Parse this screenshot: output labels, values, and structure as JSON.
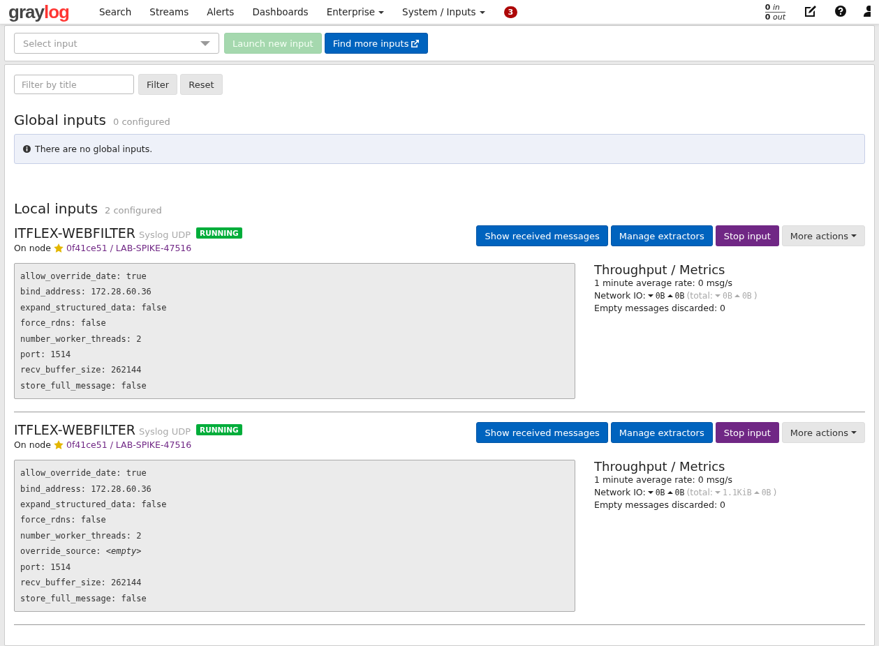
{
  "navbar": {
    "logo": {
      "first": "gray",
      "second": "log"
    },
    "items": [
      {
        "label": "Search",
        "has_menu": false
      },
      {
        "label": "Streams",
        "has_menu": false
      },
      {
        "label": "Alerts",
        "has_menu": false
      },
      {
        "label": "Dashboards",
        "has_menu": false
      },
      {
        "label": "Enterprise",
        "has_menu": true
      },
      {
        "label": "System / Inputs",
        "has_menu": true
      }
    ],
    "notification_count": "3",
    "throughput_in": "**0** *in*",
    "throughput_out": "**0** *out*"
  },
  "launch_bar": {
    "select_placeholder": "Select input",
    "launch_button": {
      "label": "Launch new input",
      "disabled": true
    },
    "find_button": "Find more inputs"
  },
  "filter": {
    "placeholder": "Filter by title",
    "filter_button": "Filter",
    "reset_button": "Reset"
  },
  "global_inputs": {
    "title": "Global inputs",
    "count": "0 configured",
    "notice": "There are no global inputs."
  },
  "local_inputs": {
    "title": "Local inputs",
    "count": "2 configured",
    "inputs": [
      {
        "name": "ITFLEX-WEBFILTER",
        "type": "Syslog UDP",
        "status": "RUNNING",
        "node_label": "On node",
        "node": "0f41ce51 / LAB-SPIKE-47516",
        "actions": [
          "Show received messages",
          "Manage extractors",
          "Stop input",
          "More actions"
        ],
        "config": [
          "allow_override_date: true",
          "bind_address: 172.28.60.36",
          "expand_structured_data: false",
          "force_rdns: false",
          "number_worker_threads: 2",
          "port: 1514",
          "recv_buffer_size: 262144",
          "store_full_message: false"
        ],
        "metrics": {
          "title": "Throughput / Metrics",
          "rate": "1 minute average rate: 0 msg/s",
          "network_label": "Network IO:",
          "rx": "0B",
          "tx": "0B",
          "total_label": "(total:",
          "total_rx": "0B",
          "total_tx": "0B",
          "total_close": ")",
          "discarded": "Empty messages discarded: 0"
        }
      },
      {
        "name": "ITFLEX-WEBFILTER",
        "type": "Syslog UDP",
        "status": "RUNNING",
        "node_label": "On node",
        "node": "0f41ce51 / LAB-SPIKE-47516",
        "actions": [
          "Show received messages",
          "Manage extractors",
          "Stop input",
          "More actions"
        ],
        "config": [
          "allow_override_date: true",
          "bind_address: 172.28.60.36",
          "expand_structured_data: false",
          "force_rdns: false",
          "number_worker_threads: 2",
          "override_source: *<empty>*",
          "port: 1514",
          "recv_buffer_size: 262144",
          "store_full_message: false"
        ],
        "metrics": {
          "title": "Throughput / Metrics",
          "rate": "1 minute average rate: 0 msg/s",
          "network_label": "Network IO:",
          "rx": "0B",
          "tx": "0B",
          "total_label": "(total:",
          "total_rx": "1.1KiB",
          "total_tx": "0B",
          "total_close": ")",
          "discarded": "Empty messages discarded: 0"
        }
      }
    ]
  }
}
